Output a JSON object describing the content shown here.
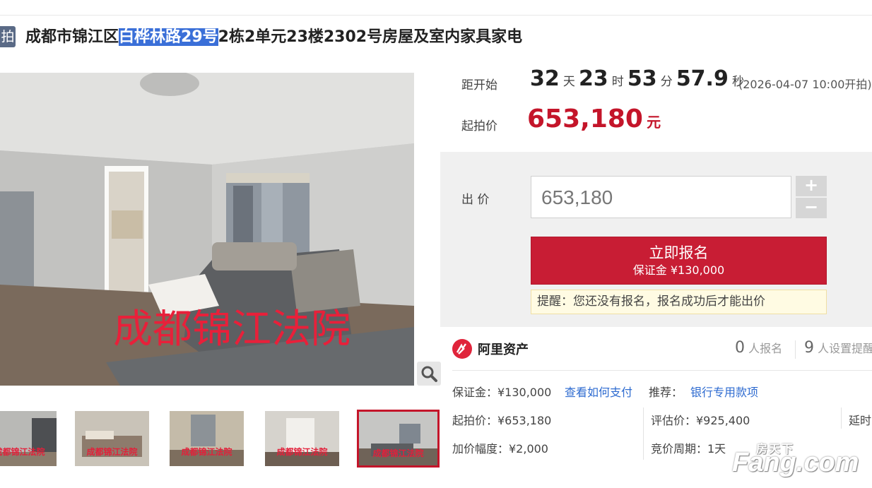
{
  "header": {
    "tag": "拍",
    "title_pre": "成都市锦江区",
    "title_highlight": "白桦林路29号",
    "title_post": "2栋2单元23楼2302号房屋及室内家具家电"
  },
  "gallery": {
    "main_watermark": "成都锦江法院",
    "thumbs": [
      {
        "caption": "成都锦江法院"
      },
      {
        "caption": "成都锦江法院"
      },
      {
        "caption": "成都锦江法院"
      },
      {
        "caption": "成都锦江法院"
      },
      {
        "caption": "成都锦江法院"
      }
    ]
  },
  "auction": {
    "countdown_label": "距开始",
    "days": "32",
    "days_unit": "天",
    "hours": "23",
    "hours_unit": "时",
    "minutes": "53",
    "minutes_unit": "分",
    "seconds": "57.9",
    "seconds_unit": "秒",
    "start_info": "(2026-04-07 10:00开拍)",
    "start_price_label": "起拍价",
    "start_price": "653,180",
    "start_price_unit": "元",
    "bid_label": "出 价",
    "bid_value": "653,180",
    "plus": "+",
    "minus": "−",
    "signup_label": "立即报名",
    "deposit_label": "保证金 ¥130,000",
    "reminder": "提醒：您还没有报名，报名成功后才能出价"
  },
  "platform": {
    "name": "阿里资产",
    "signups_count": "0",
    "signups_label": "人报名",
    "reminders_count": "9",
    "reminders_label": "人设置提醒"
  },
  "details": {
    "deposit": "保证金：¥130,000",
    "how_to_pay": "查看如何支付",
    "recommend_label": "推荐：",
    "recommend_link": "银行专用款项",
    "start_price": "起拍价：¥653,180",
    "valuation": "评估价：¥925,400",
    "delay": "延时",
    "increment": "加价幅度：¥2,000",
    "cycle": "竞价周期：1天"
  },
  "watermark": {
    "cn": "房天下",
    "en": "Fang.com"
  },
  "colors": {
    "accent_red": "#c4152a",
    "link_blue": "#2e6bd0",
    "title_highlight": "#3a6fd8"
  }
}
